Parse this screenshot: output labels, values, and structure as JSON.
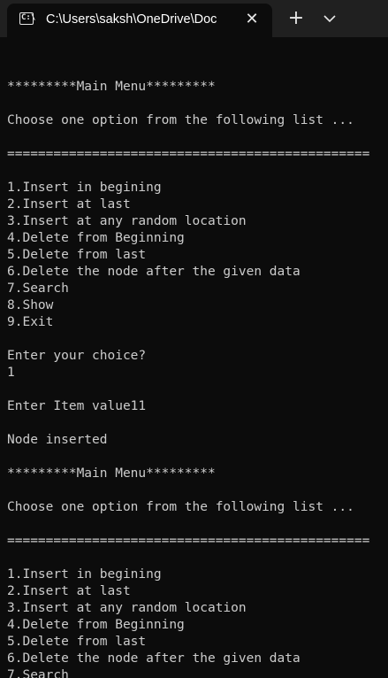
{
  "tab": {
    "icon": "terminal-icon",
    "title": "C:\\Users\\saksh\\OneDrive\\Doc",
    "close_glyph": "✕",
    "close_icon": "close-icon"
  },
  "toolbar": {
    "new_tab_glyph": "+",
    "new_tab_icon": "plus-icon",
    "dropdown_icon": "chevron-down-icon"
  },
  "console": {
    "lines": [
      "",
      "*********Main Menu*********",
      "",
      "Choose one option from the following list ...",
      "",
      "===============================================",
      "",
      "1.Insert in begining",
      "2.Insert at last",
      "3.Insert at any random location",
      "4.Delete from Beginning",
      "5.Delete from last",
      "6.Delete the node after the given data",
      "7.Search",
      "8.Show",
      "9.Exit",
      "",
      "Enter your choice?",
      "1",
      "",
      "Enter Item value11",
      "",
      "Node inserted",
      "",
      "*********Main Menu*********",
      "",
      "Choose one option from the following list ...",
      "",
      "===============================================",
      "",
      "1.Insert in begining",
      "2.Insert at last",
      "3.Insert at any random location",
      "4.Delete from Beginning",
      "5.Delete from last",
      "6.Delete the node after the given data",
      "7.Search"
    ]
  },
  "colors": {
    "background": "#0c0c0c",
    "titlebar": "#202020",
    "text": "#cccccc"
  }
}
